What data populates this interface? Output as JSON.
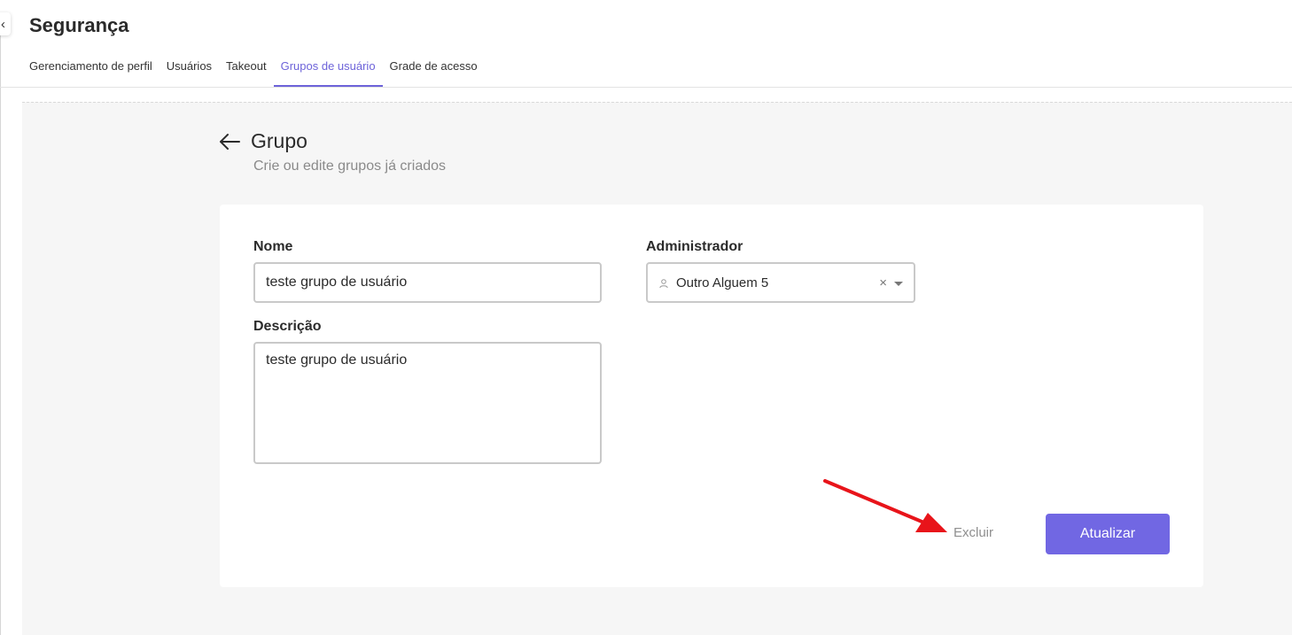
{
  "header": {
    "title": "Segurança",
    "collapse_glyph": "‹"
  },
  "tabs": [
    {
      "label": "Gerenciamento de perfil",
      "active": false
    },
    {
      "label": "Usuários",
      "active": false
    },
    {
      "label": "Takeout",
      "active": false
    },
    {
      "label": "Grupos de usuário",
      "active": true
    },
    {
      "label": "Grade de acesso",
      "active": false
    }
  ],
  "section": {
    "title": "Grupo",
    "subtitle": "Crie ou edite grupos já criados"
  },
  "form": {
    "name_label": "Nome",
    "name_value": "teste grupo de usuário",
    "description_label": "Descrição",
    "description_value": "teste grupo de usuário",
    "admin_label": "Administrador",
    "admin_value": "Outro Alguem 5",
    "clear_glyph": "×"
  },
  "actions": {
    "delete_label": "Excluir",
    "update_label": "Atualizar"
  },
  "colors": {
    "accent": "#6d63d9",
    "button": "#7167e3",
    "annotation": "#e8141a"
  }
}
